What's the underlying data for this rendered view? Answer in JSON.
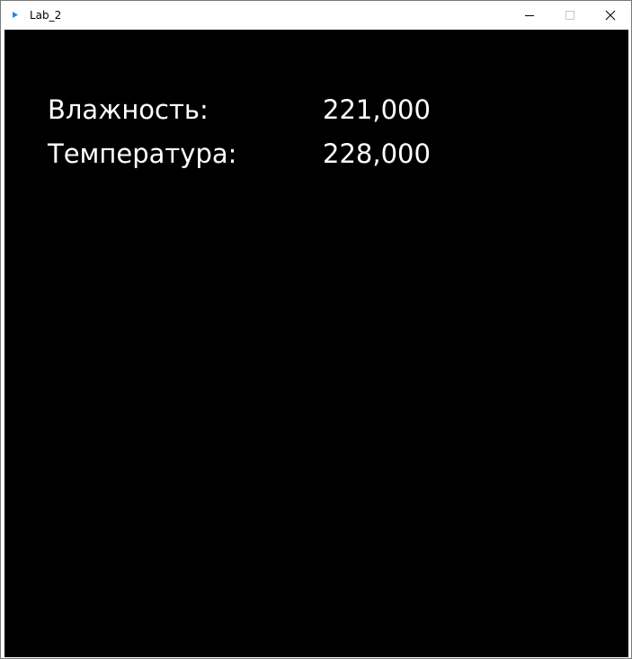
{
  "window": {
    "title": "Lab_2",
    "icon": "app-play-icon",
    "caption_buttons": [
      "minimize-icon",
      "maximize-icon",
      "close-icon"
    ],
    "background_color": "#000000",
    "text_color": "#ffffff"
  },
  "readings": [
    {
      "label": "Влажность:",
      "value": "221,000"
    },
    {
      "label": "Температура:",
      "value": "228,000"
    }
  ]
}
